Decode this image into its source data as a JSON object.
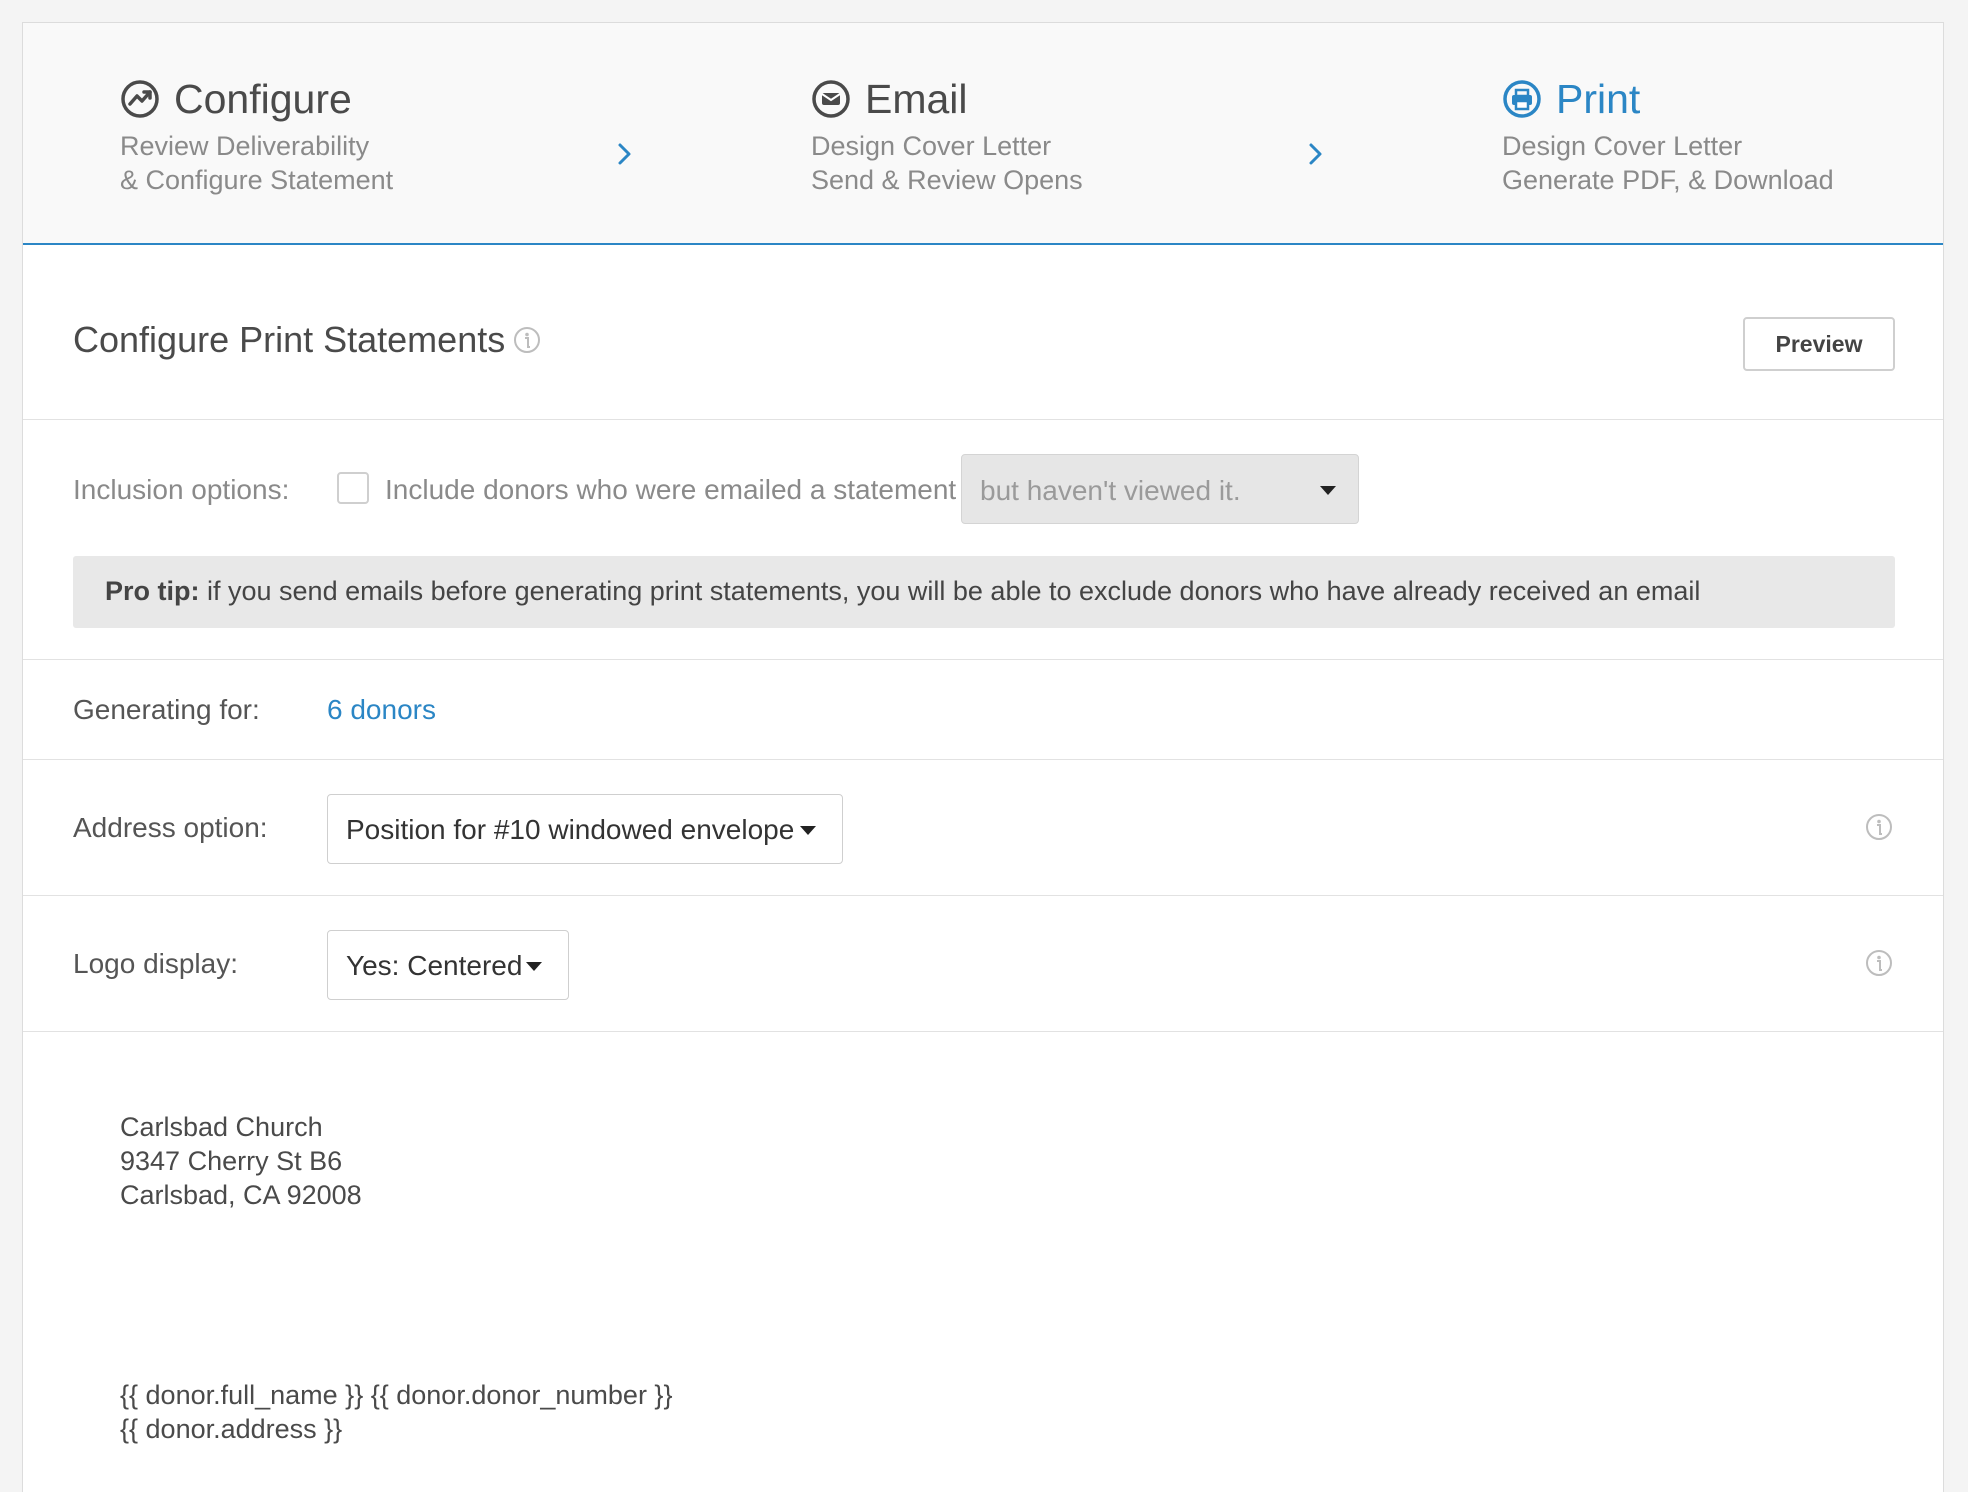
{
  "stepper": {
    "steps": [
      {
        "title": "Configure",
        "line1": "Review Deliverability",
        "line2": "& Configure Statement",
        "icon": "trend-icon"
      },
      {
        "title": "Email",
        "line1": "Design Cover Letter",
        "line2": "Send & Review Opens",
        "icon": "email-icon"
      },
      {
        "title": "Print",
        "line1": "Design Cover Letter",
        "line2": "Generate PDF, & Download",
        "icon": "print-icon"
      }
    ],
    "active_color": "#2b86c5"
  },
  "header": {
    "title": "Configure Print Statements",
    "preview_label": "Preview"
  },
  "inclusion": {
    "label": "Inclusion options:",
    "checkbox_label": "Include donors who were emailed a statement",
    "select_value": "but haven't viewed it.",
    "protip_bold": "Pro tip:",
    "protip_text": " if you send emails before generating print statements, you will be able to exclude donors who have already received an email"
  },
  "generating": {
    "label": "Generating for:",
    "link": "6 donors"
  },
  "address": {
    "label": "Address option:",
    "select_value": "Position for #10 windowed envelope"
  },
  "logo": {
    "label": "Logo display:",
    "select_value": "Yes: Centered"
  },
  "preview": {
    "church": [
      "Carlsbad Church",
      "9347 Cherry St B6",
      "Carlsbad, CA 92008"
    ],
    "donor": [
      "{{ donor.full_name }} {{ donor.donor_number }}",
      "{{ donor.address }}"
    ]
  }
}
